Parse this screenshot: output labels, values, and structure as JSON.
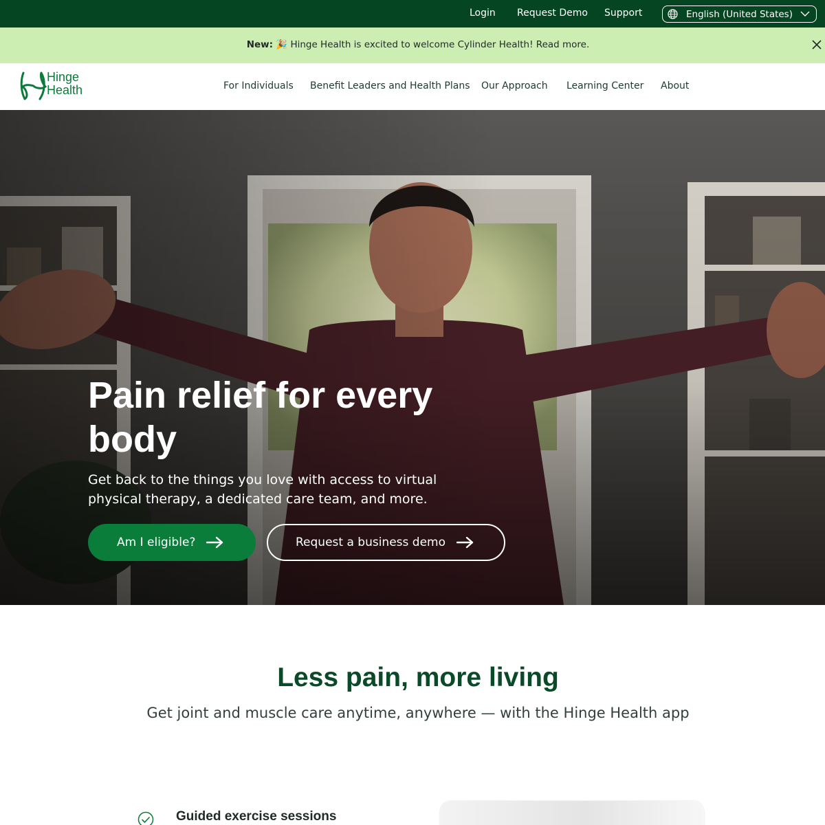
{
  "utility_nav": {
    "links": [
      "Login",
      "Request Demo",
      "Support"
    ],
    "language": "English (United States)"
  },
  "announcement": {
    "prefix": "New:",
    "emoji": "🎉",
    "text": "Hinge Health is excited to welcome Cylinder Health! Read more."
  },
  "brand": {
    "name_line1": "Hinge",
    "name_line2": "Health",
    "color": "#0b7a3b"
  },
  "main_nav": {
    "items": [
      "For Individuals",
      "Benefit Leaders and Health Plans",
      "Our Approach",
      "Learning Center",
      "About"
    ]
  },
  "hero": {
    "title": "Pain relief for every body",
    "subtitle": "Get back to the things you love with access to virtual physical therapy, a dedicated care team, and more.",
    "primary_cta": "Am I eligible?",
    "secondary_cta": "Request a business demo"
  },
  "section": {
    "title": "Less pain, more living",
    "subtitle": "Get joint and muscle care anytime, anywhere — with the Hinge Health app",
    "features": [
      {
        "title": "Guided exercise sessions"
      }
    ]
  },
  "icons": {
    "language": "globe-icon",
    "language_toggle": "chevron-down-icon",
    "close": "close-icon",
    "cta_arrow": "arrow-right-icon",
    "feature_check": "check-circle-icon",
    "logo": "hinge-logo-icon"
  },
  "colors": {
    "top_bar": "#064521",
    "announcement_bg": "#cdeeb3",
    "primary_button": "#0b7d3a",
    "heading_green": "#0a4a28"
  }
}
